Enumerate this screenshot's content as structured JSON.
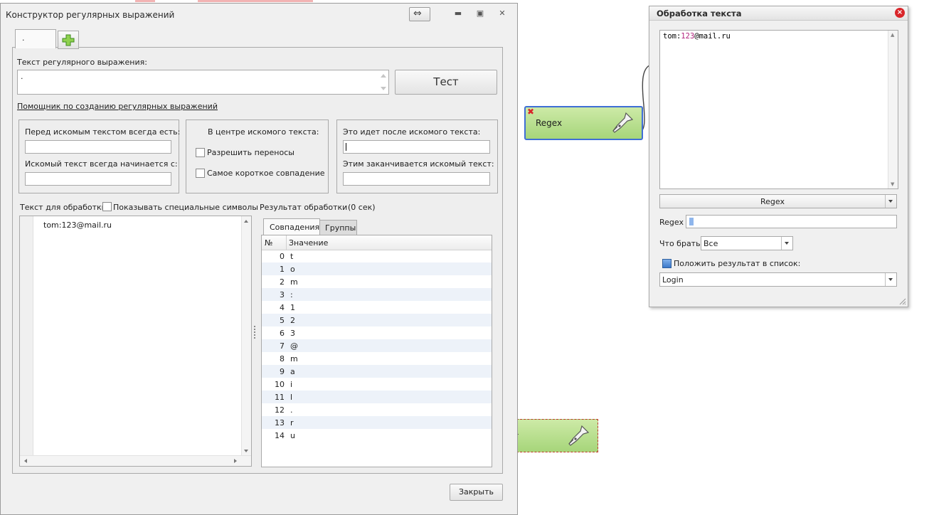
{
  "dialog": {
    "title": "Конструктор регулярных выражений",
    "tab_label": ".",
    "regex_label": "Текст регулярного выражения:",
    "regex_value": ".",
    "test_button": "Тест",
    "helper_link": "Помощник по созданию регулярных выражений",
    "before": {
      "always_label": "Перед искомым текстом всегда есть:",
      "always_value": "",
      "starts_label": "Искомый текст всегда начинается с:",
      "starts_value": ""
    },
    "center": {
      "title": "В центре искомого текста:",
      "allow_breaks": "Разрешить переносы",
      "shortest_match": "Самое короткое совпадение"
    },
    "after": {
      "after_label": "Это идет после искомого текста:",
      "after_value": "",
      "ends_label": "Этим заканчивается искомый текст:",
      "ends_value": ""
    },
    "source_label": "Текст для обработки",
    "show_special": "Показывать специальные символы",
    "source_text": "tom:123@mail.ru",
    "result_label": "Результат обработки",
    "result_time": "(0 сек)",
    "tabs": [
      "Совпадения",
      "Группы"
    ],
    "grid_headers": {
      "num": "№",
      "value": "Значение"
    },
    "matches": [
      {
        "n": "0",
        "v": "t"
      },
      {
        "n": "1",
        "v": "o"
      },
      {
        "n": "2",
        "v": "m"
      },
      {
        "n": "3",
        "v": ":"
      },
      {
        "n": "4",
        "v": "1"
      },
      {
        "n": "5",
        "v": "2"
      },
      {
        "n": "6",
        "v": "3"
      },
      {
        "n": "7",
        "v": "@"
      },
      {
        "n": "8",
        "v": "m"
      },
      {
        "n": "9",
        "v": "a"
      },
      {
        "n": "10",
        "v": "i"
      },
      {
        "n": "11",
        "v": "l"
      },
      {
        "n": "12",
        "v": "."
      },
      {
        "n": "13",
        "v": "r"
      },
      {
        "n": "14",
        "v": "u"
      }
    ],
    "close_button": "Закрыть"
  },
  "node": {
    "label": "Regex"
  },
  "panel": {
    "title": "Обработка текста",
    "text_prefix": "tom:",
    "text_num": "123",
    "text_suffix": "@mail.ru",
    "mode": "Regex",
    "regex_label": "Regex",
    "what_label": "Что брать",
    "what_value": "Все",
    "put_label": "Положить результат в список:",
    "list_value": "Login"
  },
  "colors": {
    "accent": "#3f6fd6",
    "node_green": "#b6df8c",
    "close_red": "#d9252a",
    "number_magenta": "#b2227d"
  }
}
